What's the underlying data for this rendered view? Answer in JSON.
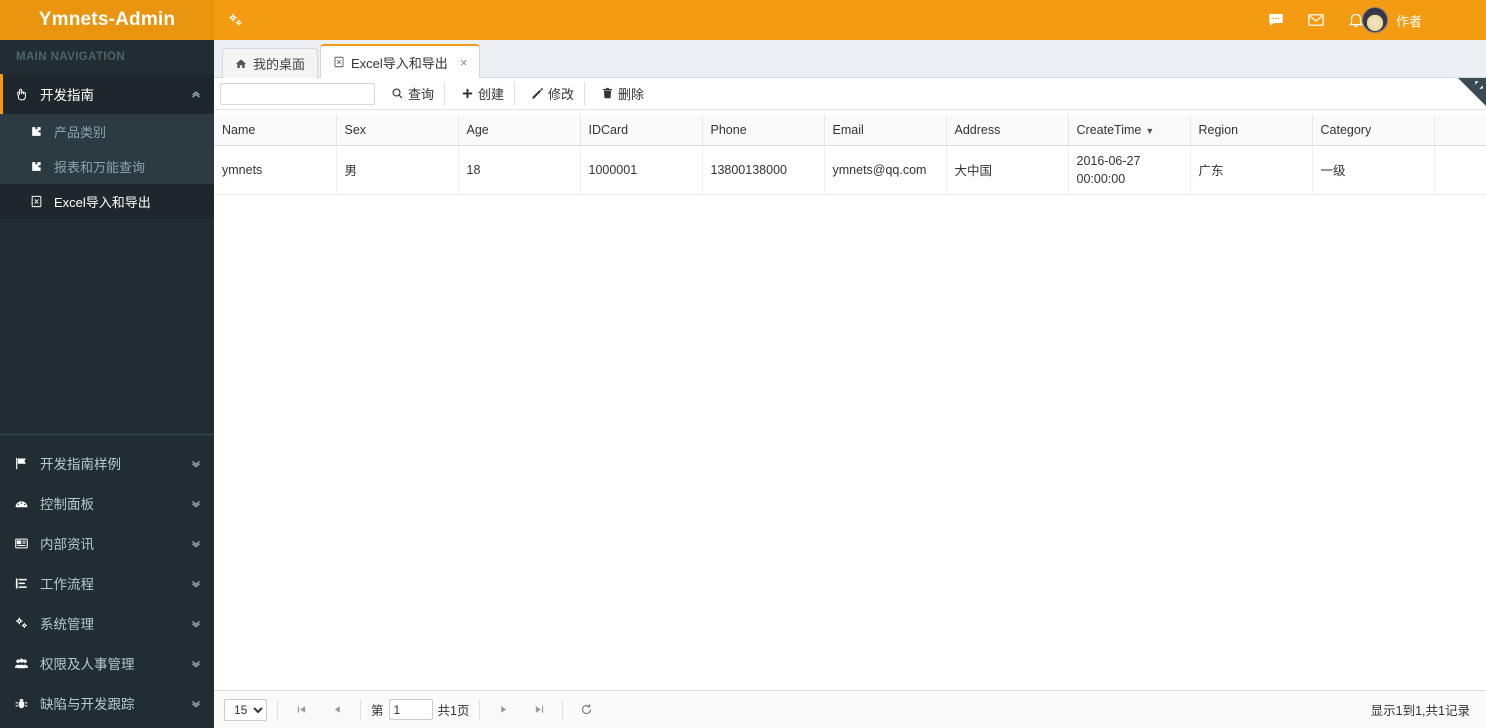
{
  "header": {
    "logo_text": "Ymnets-Admin",
    "toggle_icon": "gears-icon",
    "icons": [
      {
        "name": "chat-icon",
        "glyph": "…"
      },
      {
        "name": "envelope-icon",
        "glyph": "✉"
      },
      {
        "name": "bell-icon",
        "glyph": "ὑ4"
      }
    ],
    "user_name": "作者"
  },
  "sidebar": {
    "title": "MAIN NAVIGATION",
    "open_group": {
      "label": "开发指南",
      "icon": "hand-pointer-icon",
      "arrow": "chevron-up-icon",
      "children": [
        {
          "label": "产品类别",
          "icon": "puzzle-icon",
          "active": false
        },
        {
          "label": "报表和万能查询",
          "icon": "puzzle-icon",
          "active": false
        },
        {
          "label": "Excel导入和导出",
          "icon": "excel-file-icon",
          "active": true
        }
      ]
    },
    "items": [
      {
        "label": "开发指南样例",
        "icon": "flag-icon"
      },
      {
        "label": "控制面板",
        "icon": "dashboard-icon"
      },
      {
        "label": "内部资讯",
        "icon": "newspaper-icon"
      },
      {
        "label": "工作流程",
        "icon": "tasks-icon"
      },
      {
        "label": "系统管理",
        "icon": "gears-icon"
      },
      {
        "label": "权限及人事管理",
        "icon": "users-icon"
      },
      {
        "label": "缺陷与开发跟踪",
        "icon": "bug-icon"
      }
    ]
  },
  "tabs": [
    {
      "label": "我的桌面",
      "icon": "home-icon",
      "active": false,
      "closable": false
    },
    {
      "label": "Excel导入和导出",
      "icon": "excel-file-icon",
      "active": true,
      "closable": true,
      "close_glyph": "×"
    }
  ],
  "toolbar": {
    "search_value": "",
    "search_placeholder": "",
    "buttons": [
      {
        "label": "查询",
        "icon": "search-icon"
      },
      {
        "label": "创建",
        "icon": "plus-icon"
      },
      {
        "label": "修改",
        "icon": "pencil-icon"
      },
      {
        "label": "删除",
        "icon": "trash-icon"
      }
    ]
  },
  "grid": {
    "columns": [
      {
        "label": "Name",
        "sorted": false
      },
      {
        "label": "Sex",
        "sorted": false
      },
      {
        "label": "Age",
        "sorted": false
      },
      {
        "label": "IDCard",
        "sorted": false
      },
      {
        "label": "Phone",
        "sorted": false
      },
      {
        "label": "Email",
        "sorted": false
      },
      {
        "label": "Address",
        "sorted": false
      },
      {
        "label": "CreateTime",
        "sorted": true,
        "sort_caret": "▼"
      },
      {
        "label": "Region",
        "sorted": false
      },
      {
        "label": "Category",
        "sorted": false
      },
      {
        "label": "",
        "sorted": false
      }
    ],
    "rows": [
      {
        "name": "ymnets",
        "sex": "男",
        "age": "18",
        "idcard": "1000001",
        "phone": "13800138000",
        "email": "ymnets@qq.com",
        "address": "大中国",
        "createtime": "2016-06-27\n00:00:00",
        "region": "广东",
        "category": "一级",
        "extra": ""
      }
    ]
  },
  "pager": {
    "page_size": "15",
    "page_size_options": [
      "15"
    ],
    "first_icon": "step-backward-icon",
    "prev_icon": "caret-left-icon",
    "next_icon": "caret-right-icon",
    "last_icon": "step-forward-icon",
    "refresh_icon": "refresh-icon",
    "page_prefix": "第",
    "page_value": "1",
    "page_total": "共1页",
    "info": "显示1到1,共1记录"
  },
  "colors": {
    "brand_orange": "#f39c12",
    "logo_orange": "#e9950f",
    "sidebar_dark": "#222d32",
    "sidebar_active": "#1e282c",
    "submenu_bg": "#2c3b41",
    "content_bg": "#ecf0f5"
  }
}
